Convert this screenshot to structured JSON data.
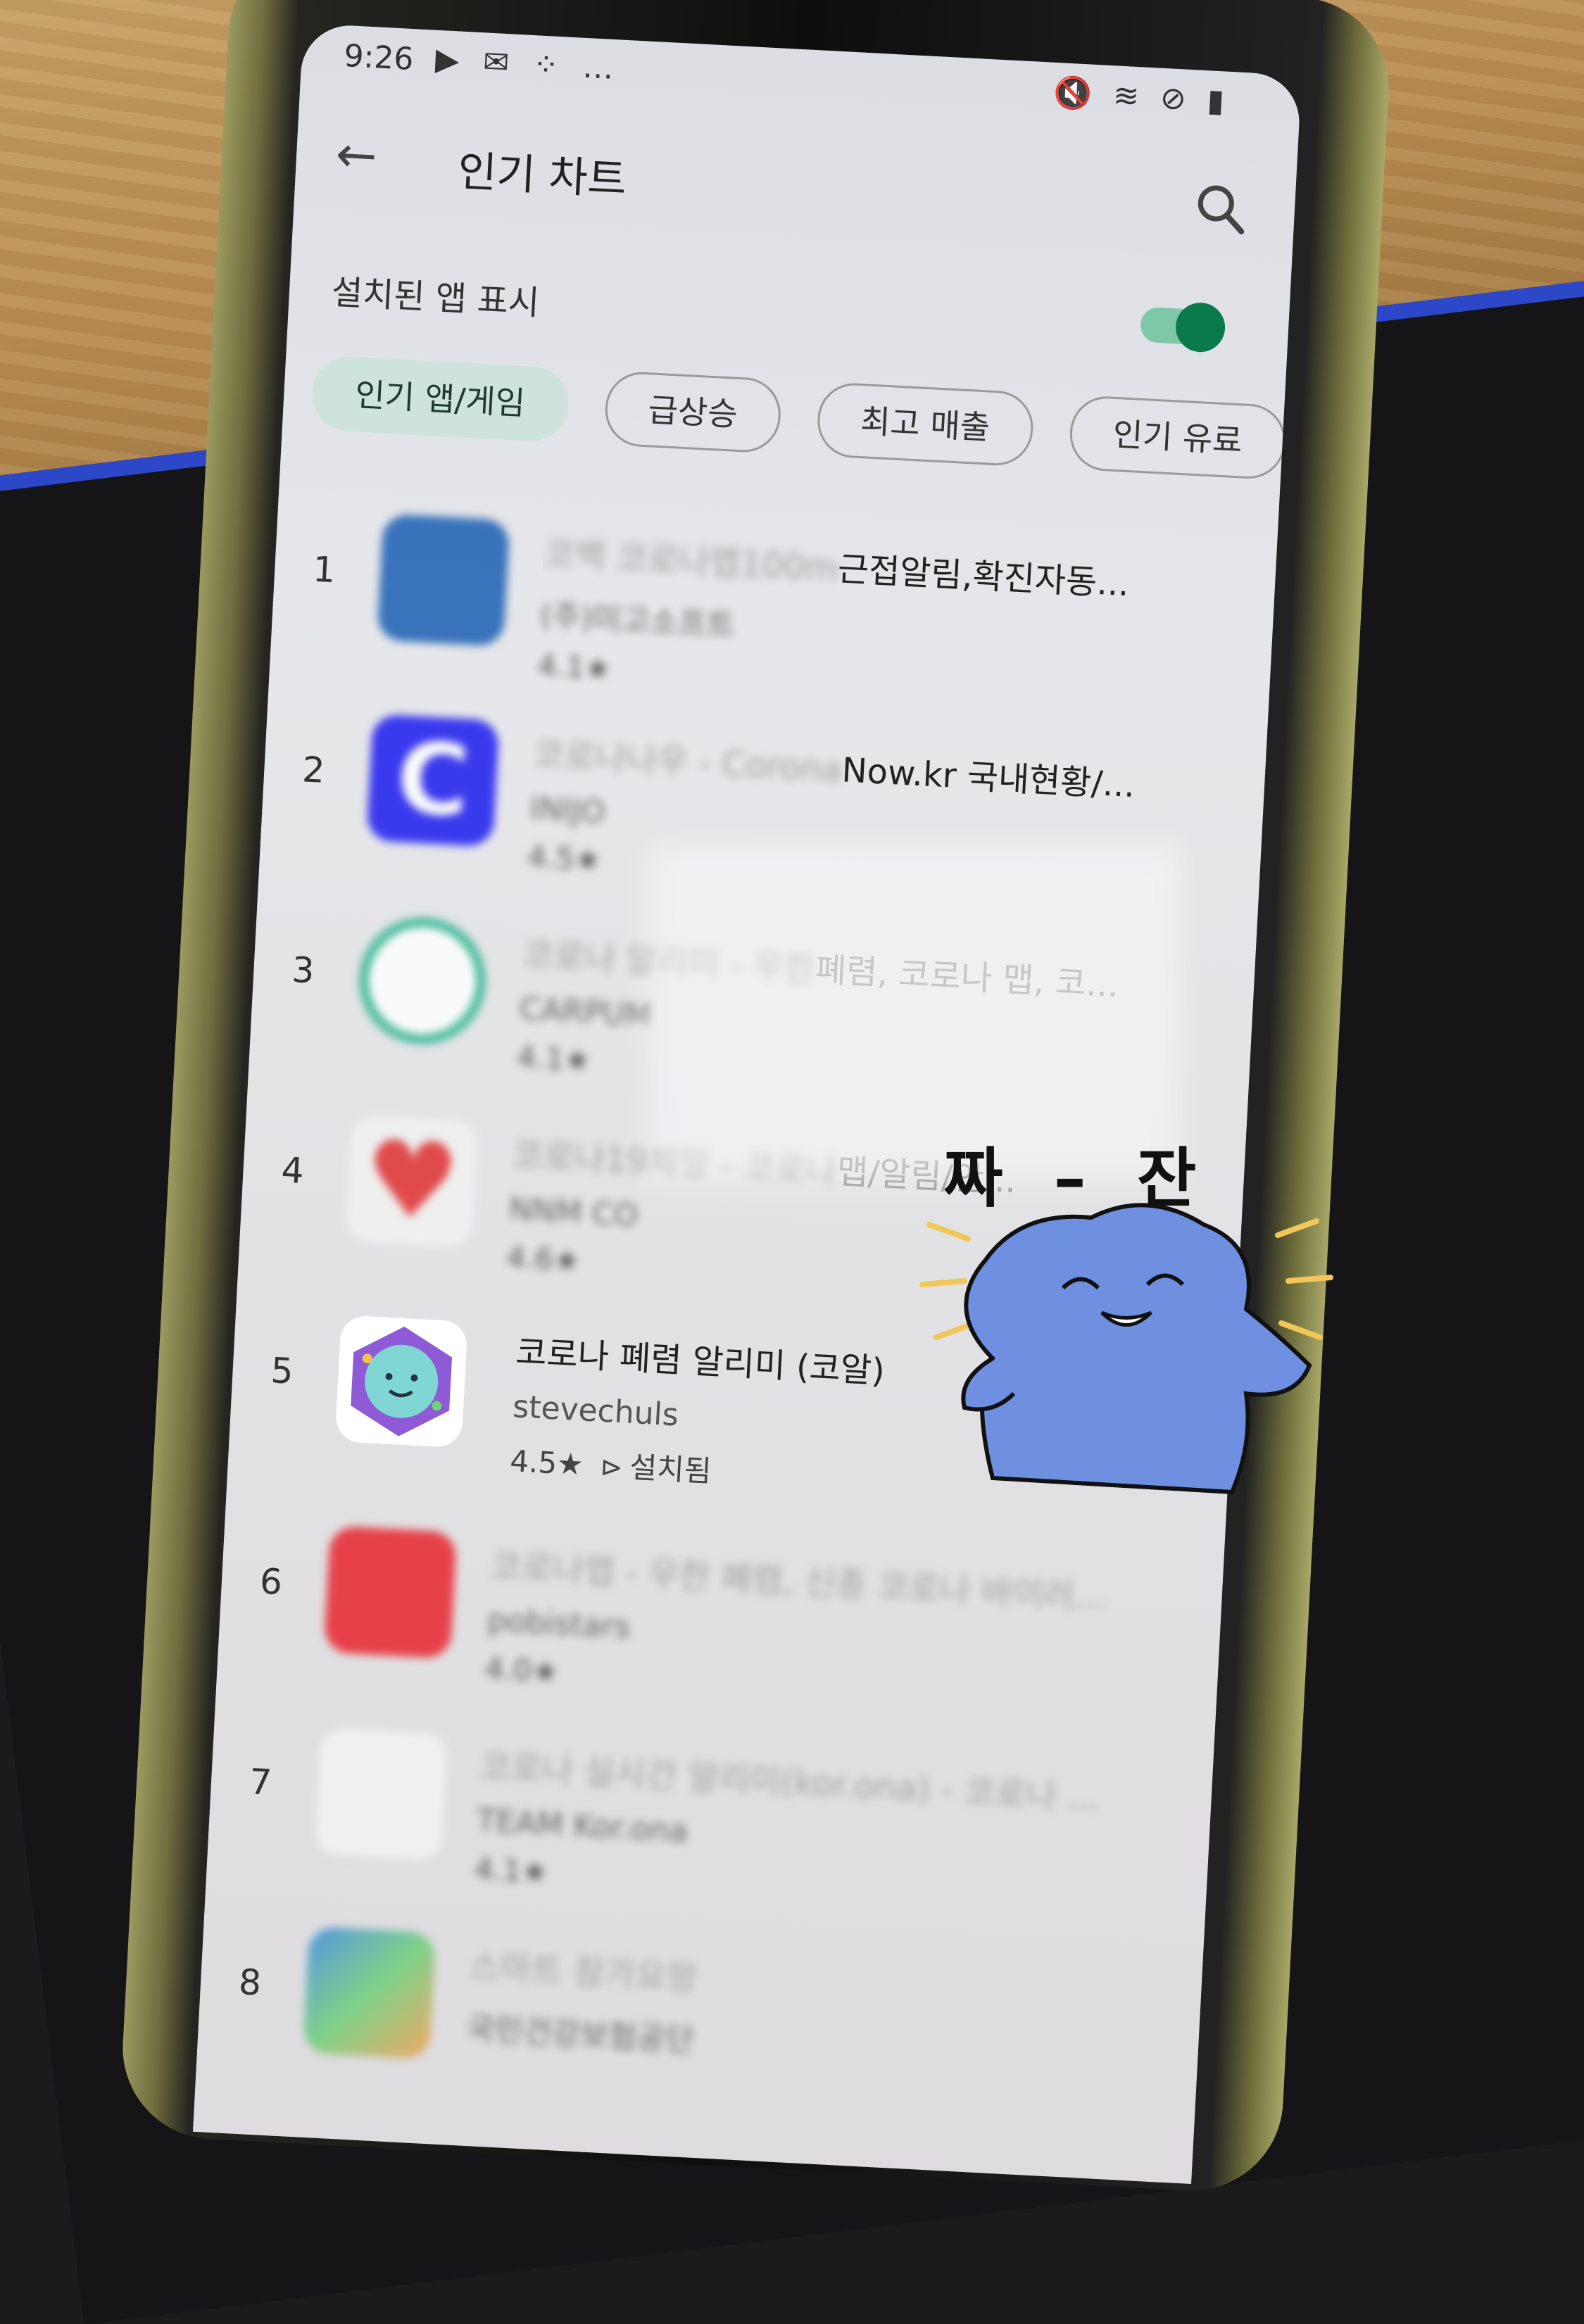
{
  "status_bar": {
    "time": "9:26",
    "notification_icons": "▶ ✉ ⁘ …",
    "system_icons": "🔇 ≋ ⊘ ▮"
  },
  "app_bar": {
    "title": "인기 차트",
    "back_icon": "arrow-left-icon",
    "search_icon": "search-icon"
  },
  "filter": {
    "label": "설치된 앱 표시",
    "enabled": true
  },
  "chips": [
    {
      "label": "인기 앱/게임",
      "active": true
    },
    {
      "label": "급상승",
      "active": false
    },
    {
      "label": "최고 매출",
      "active": false
    },
    {
      "label": "인기 유료",
      "active": false
    }
  ],
  "apps": [
    {
      "rank": "1",
      "name_blurred": "코백 코로나맵100m",
      "name_visible": "근접알림,확진자동...",
      "developer": "(주)미고소프트",
      "rating": "4.1★",
      "icon_color": "#1a5fb4"
    },
    {
      "rank": "2",
      "name_blurred": "코로나나우 - Corona",
      "name_visible": "Now.kr  국내현황/...",
      "developer": "INIJO",
      "rating": "4.5★",
      "icon_color": "#1c1cf0",
      "icon_letter": "C"
    },
    {
      "rank": "3",
      "name_blurred": "코로나 알리미 - 우한",
      "name_visible": "폐렴, 코로나 맵, 코...",
      "developer": "CARPUM",
      "rating": "4.1★",
      "icon_color": "#2fb58e"
    },
    {
      "rank": "4",
      "name_blurred": "코로나19체망 - 코로나",
      "name_visible": "맵/알림/안...",
      "developer": "NNM CO",
      "rating": "4.6★",
      "icon_color": "#e03030"
    },
    {
      "rank": "5",
      "name_visible": "코로나 폐렴 알리미 (코알)",
      "developer": "stevechuls",
      "rating": "4.5★",
      "installed": "설치됨",
      "icon_color": "#8e5ad6"
    },
    {
      "rank": "6",
      "name_blurred": "코로나맵 - 우한 폐렴, 신종 코로나 바이러...",
      "developer": "pobistars",
      "rating": "4.0★",
      "icon_color": "#e8262e"
    },
    {
      "rank": "7",
      "name_blurred": "코로나 실시간 알리미(kor.ona) - 코로나 ...",
      "developer": "TEAM Kor.ona",
      "rating": "4.1★",
      "icon_color": "#f4f4f4"
    },
    {
      "rank": "8",
      "name_blurred": "스마트 참가요망",
      "developer": "국민건강보험공단",
      "rating": "",
      "icon_color": "#3b8be0"
    }
  ],
  "sticker": {
    "text": "짜 – 잔",
    "color": "#6f8fe0"
  }
}
